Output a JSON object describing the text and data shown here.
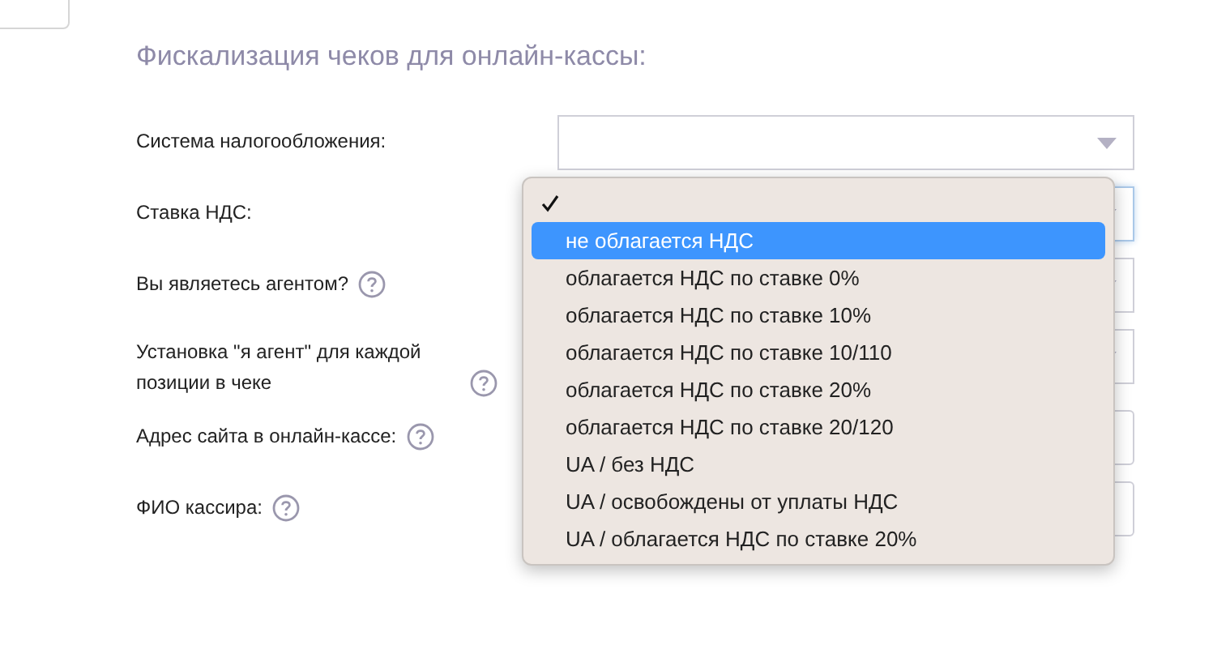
{
  "heading": "Фискализация чеков для онлайн-кассы:",
  "fields": [
    {
      "label": "Система налогообложения:",
      "help": false,
      "kind": "select"
    },
    {
      "label": "Ставка НДС:",
      "help": false,
      "kind": "select"
    },
    {
      "label": "Вы являетесь агентом?",
      "help": true,
      "kind": "select"
    },
    {
      "label": "Установка \"я агент\" для каждой позиции в чеке",
      "help": true,
      "kind": "select"
    },
    {
      "label": "Адрес сайта в онлайн-кассе:",
      "help": true,
      "kind": "input"
    },
    {
      "label": "ФИО кассира:",
      "help": true,
      "kind": "input"
    }
  ],
  "dropdown": {
    "options": [
      {
        "checked": true,
        "highlighted": false
      },
      {
        "label": "не облагается НДС",
        "checked": false,
        "highlighted": true
      },
      {
        "label": "облагается НДС по ставке 0%",
        "checked": false,
        "highlighted": false
      },
      {
        "label": "облагается НДС по ставке 10%",
        "checked": false,
        "highlighted": false
      },
      {
        "label": "облагается НДС по ставке 10/110",
        "checked": false,
        "highlighted": false
      },
      {
        "label": "облагается НДС по ставке 20%",
        "checked": false,
        "highlighted": false
      },
      {
        "label": "облагается НДС по ставке 20/120",
        "checked": false,
        "highlighted": false
      },
      {
        "label": "UA / без НДС",
        "checked": false,
        "highlighted": false
      },
      {
        "label": "UA / освобождены от уплаты НДС",
        "checked": false,
        "highlighted": false
      },
      {
        "label": "UA / облагается НДС по ставке 20%",
        "checked": false,
        "highlighted": false
      }
    ]
  }
}
